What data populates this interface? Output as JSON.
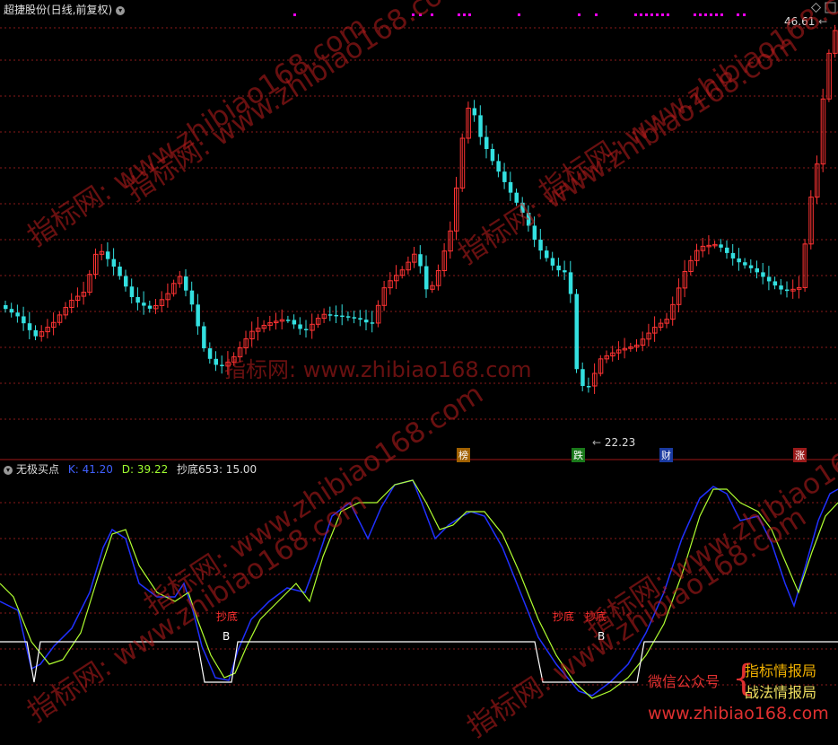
{
  "stock": {
    "title": "超捷股份(日线,前复权)"
  },
  "price_panel": {
    "high_label": "46.61",
    "low_label": "22.23"
  },
  "event_tags": [
    {
      "text": "榜",
      "bg": "#a06000",
      "fg": "#ffffff"
    },
    {
      "text": "跌",
      "bg": "#1a7a1a",
      "fg": "#ffffff"
    },
    {
      "text": "财",
      "bg": "#1a3aa0",
      "fg": "#ffffff"
    },
    {
      "text": "涨",
      "bg": "#9a1a1a",
      "fg": "#ffffff"
    }
  ],
  "indicator": {
    "name": "无极买点",
    "k_label": "K: 41.20",
    "d_label": "D: 39.22",
    "chaodi_label": "抄底653: 15.00",
    "signal_text": "抄底",
    "b_text": "B"
  },
  "watermark": {
    "text": "指标网: www.zhibiao168.com"
  },
  "promo": {
    "left": "微信公众号",
    "bracket": "{",
    "right1": "指标情报局",
    "right2": "战法情报局",
    "site": "www.zhibiao168.com"
  },
  "colors": {
    "up": "#ff3333",
    "down": "#33e0e0",
    "k_line": "#2030ff",
    "d_line": "#b0ff30",
    "grid": "#8a1a1a",
    "magenta": "#ff00ff"
  }
}
